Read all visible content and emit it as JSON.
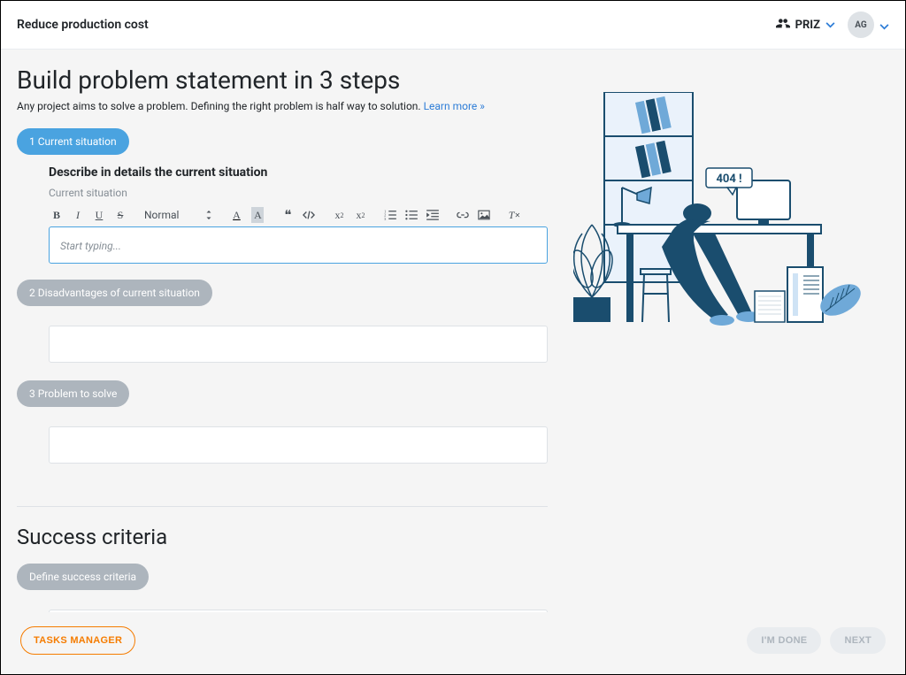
{
  "header": {
    "title": "Reduce production cost",
    "org_name": "PRIZ",
    "avatar_initials": "AG"
  },
  "page": {
    "title": "Build problem statement in 3 steps",
    "subtitle": "Any project aims to solve a problem. Defining the right problem is half way to solution.",
    "learn_more": "Learn more »"
  },
  "steps": [
    {
      "num": "1",
      "label": "Current situation",
      "active": true
    },
    {
      "num": "2",
      "label": "Disadvantages of current situation",
      "active": false
    },
    {
      "num": "3",
      "label": "Problem to solve",
      "active": false
    }
  ],
  "step1": {
    "heading": "Describe in details the current situation",
    "field_label": "Current situation",
    "placeholder": "Start typing..."
  },
  "editor": {
    "format_label": "Normal",
    "bold": "B",
    "italic": "I",
    "underline": "U",
    "strike": "S",
    "color": "A",
    "bg": "A",
    "quote": "❝",
    "sub": "x",
    "sub2": "2",
    "sup": "x",
    "sup2": "2"
  },
  "success": {
    "title": "Success criteria",
    "pill": "Define success criteria"
  },
  "illustration": {
    "bubble_text": "404 !"
  },
  "footer": {
    "tasks": "TASKS MANAGER",
    "done": "I'M DONE",
    "next": "NEXT"
  }
}
